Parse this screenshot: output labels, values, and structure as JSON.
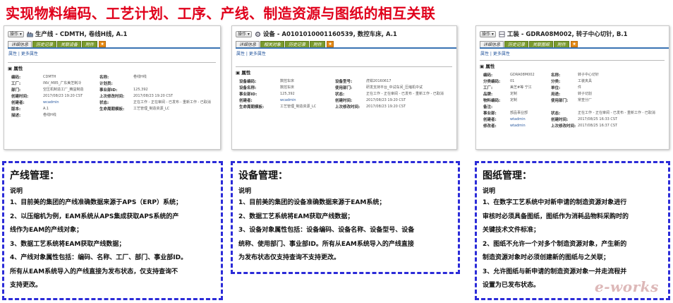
{
  "title": "实现物料编码、工艺计划、工序、产线、制造资源与图纸的相互关联",
  "panels": [
    {
      "op_label": "操作 ▾",
      "title": "生产线 - CDMTH, 卷线H线, A.1",
      "tabs": [
        "详细信息",
        "历史记录",
        "关联设备",
        "附件"
      ],
      "subnav": "属性 | 更多属性",
      "section": "属性",
      "rows": [
        [
          "编码:",
          "CDMTH",
          "名称:",
          "卷线H线"
        ],
        [
          "工厂:",
          "INV_M85_广东美芝制冷",
          "计划员:",
          ""
        ],
        [
          "部门:",
          "空压机制造工厂_精益制造",
          "事业部ID:",
          "125,392"
        ],
        [
          "创建时间:",
          "2017/08/23 19:20 CST",
          "上次修改时间:",
          "2017/08/23 19:20 CST"
        ],
        [
          "创建者:",
          "wcadmin",
          "状态:",
          "正在工作 - 正在审阅 - 已发布 - 重新工作 - 已取消"
        ],
        [
          "版本:",
          "A.1",
          "生命周期模板:",
          "工艺管理_制造资源_LC"
        ],
        [
          "描述:",
          "卷线H线",
          "",
          ""
        ]
      ]
    },
    {
      "op_label": "操作 ▾",
      "title": "设备 - A0101010001160539, 数控车床, A.1",
      "tabs": [
        "详细信息",
        "相关对象",
        "历史记录",
        "附件"
      ],
      "subnav": "属性 | 更多属性",
      "section": "属性",
      "rows": [
        [
          "设备编码:",
          "数控车床",
          "设备型号:",
          "虎钳20160617"
        ],
        [
          "设备名称:",
          "数控车床",
          "使用部门:",
          "研发支持平台_中试车间_压缩机中试"
        ],
        [
          "事业部ID:",
          "125,392",
          "状态:",
          "正在工作 - 正在审阅 - 已发布 - 重新工作 - 已取消"
        ],
        [
          "创建者:",
          "wcadmin",
          "创建时间:",
          "2017/08/23 19:20 CST"
        ],
        [
          "生命周期模板:",
          "工艺管理_制造资源_LC",
          "上次修改时间:",
          "2017/08/23 19:20 CST"
        ]
      ]
    },
    {
      "op_label": "操作 ▾",
      "title": "工装 - GDRA08M002, 转子中心切针, B.1",
      "tabs": [
        "详细信息",
        "历史记录",
        "关联图纸",
        "附件"
      ],
      "subnav": "属性 | 更多属性",
      "section": "属性",
      "rows": [
        [
          "编码:",
          "GDRA08M002",
          "名称:",
          "转子中心切针"
        ],
        [
          "分类编码:",
          "01",
          "分类:",
          "工装夹具"
        ],
        [
          "工厂:",
          "美芝#等 宁江",
          "单位:",
          "件"
        ],
        [
          "品牌:",
          "定制",
          "用途:",
          "转子切割"
        ],
        [
          "物料编码:",
          "定制",
          "使用部门:",
          "常查分厂"
        ],
        [
          "备注:",
          "",
          "",
          ""
        ],
        [
          "事业部:",
          "部品事业部",
          "状态:",
          "正在工作 - 正在审阅 - 已发布 - 重新工作 - 已取消"
        ],
        [
          "创建者:",
          "wtadmin",
          "创建时间:",
          "2017/08/25 16:33 CST"
        ],
        [
          "修改者:",
          "wtadmin",
          "上次修改时间:",
          "2017/08/25 16:37 CST"
        ]
      ]
    }
  ],
  "boxes": [
    {
      "title": "产线管理：",
      "sub": "说明",
      "lines": [
        "1、目前美的集团的产线准确数据来源于APS（ERP）系统；",
        "2、以压缩机为例，EAM系统从APS集成获取APS系统的产",
        "线作为EAM的产线对象；",
        "3、数据工艺系统将EAM获取产线数据；",
        "4、产线对象属性包括：编码、名称、工厂、部门、事业部ID。",
        "所有从EAM系统导入的产线直接为发布状态，仅支持查询不",
        "支持更改。"
      ]
    },
    {
      "title": "设备管理：",
      "sub": "说明",
      "lines": [
        "1、目前美的集团的设备准确数据来源于EAM系统；",
        "2、数据工艺系统将EAM获取产线数据；",
        "3、设备对象属性包括：设备编码、设备名称、设备型号、设备",
        "统称、使用部门、事业部ID。所有从EAM系统导入的产线直接",
        "为发布状态仅支持查询不支持更改。"
      ]
    },
    {
      "title": "图纸管理：",
      "sub": "说明",
      "lines": [
        "1、在数字工艺系统中对新申请的制造资源对象进行",
        "审核时必须具备图纸，图纸作为消耗品物料采购时的",
        "关键技术文件标准；",
        "2、图纸不允许一个对多个制造资源对象，产生新的",
        "制造资源对象时必须创建新的图纸与之关联；",
        "3、允许图纸与新申请的制造资源对象一并走流程并",
        "设置为已发布状态。"
      ]
    }
  ],
  "logo": "e-works"
}
